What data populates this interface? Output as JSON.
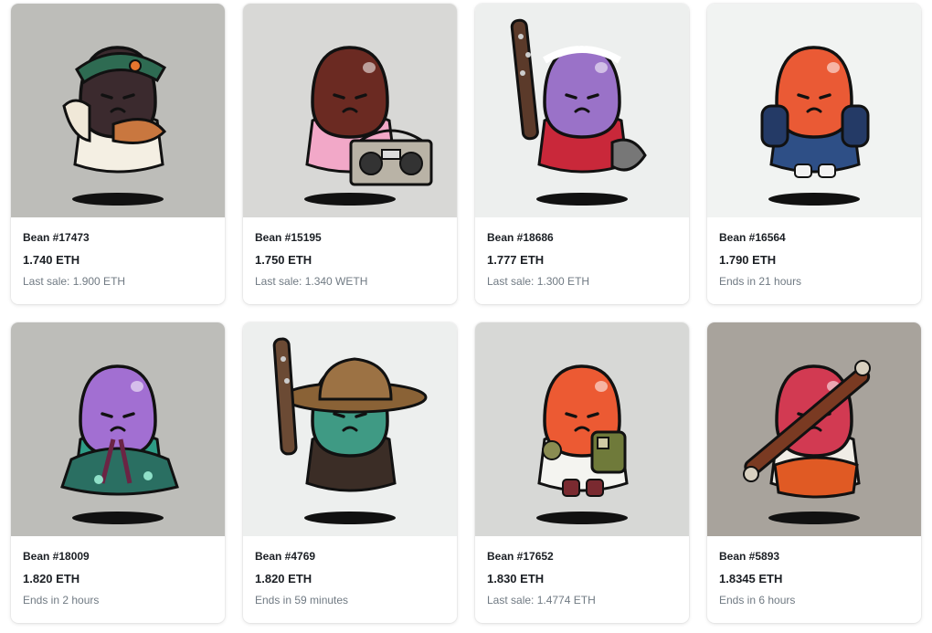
{
  "items": [
    {
      "name": "Bean #17473",
      "price": "1.740 ETH",
      "sub": "Last sale: 1.900 ETH",
      "bg": "#bdbdb9",
      "body": "#3b2a2e",
      "outfit": "#f4efe3",
      "accent": "#2e6b52",
      "prop": "hood-fur"
    },
    {
      "name": "Bean #15195",
      "price": "1.750 ETH",
      "sub": "Last sale: 1.340 WETH",
      "bg": "#d8d8d6",
      "body": "#6b2a22",
      "outfit": "#f2a8c8",
      "accent": "#b9b3a6",
      "prop": "boombox"
    },
    {
      "name": "Bean #18686",
      "price": "1.777 ETH",
      "sub": "Last sale: 1.300 ETH",
      "bg": "#edefee",
      "body": "#9a72c8",
      "outfit": "#c9283a",
      "accent": "#5b3a2a",
      "prop": "bat-axe"
    },
    {
      "name": "Bean #16564",
      "price": "1.790 ETH",
      "sub": "Ends in 21 hours",
      "bg": "#f1f3f2",
      "body": "#ea5a35",
      "outfit": "#2e4f86",
      "accent": "#f2f2f2",
      "prop": "backpack"
    },
    {
      "name": "Bean #18009",
      "price": "1.820 ETH",
      "sub": "Ends in 2 hours",
      "bg": "#bdbdb9",
      "body": "#a26fd2",
      "outfit": "#2e9c86",
      "accent": "#6b2444",
      "prop": "hanbok"
    },
    {
      "name": "Bean #4769",
      "price": "1.820 ETH",
      "sub": "Ends in 59 minutes",
      "bg": "#edefee",
      "body": "#3f9a84",
      "outfit": "#3b2d26",
      "accent": "#8a6236",
      "prop": "hat-bat"
    },
    {
      "name": "Bean #17652",
      "price": "1.830 ETH",
      "sub": "Last sale: 1.4774 ETH",
      "bg": "#d7d8d6",
      "body": "#ec5a33",
      "outfit": "#f4f4f0",
      "accent": "#6f7a3a",
      "prop": "vest"
    },
    {
      "name": "Bean #5893",
      "price": "1.8345 ETH",
      "sub": "Ends in 6 hours",
      "bg": "#a8a39c",
      "body": "#d23a52",
      "outfit": "#f0ede6",
      "accent": "#e05a24",
      "prop": "scroll"
    }
  ]
}
